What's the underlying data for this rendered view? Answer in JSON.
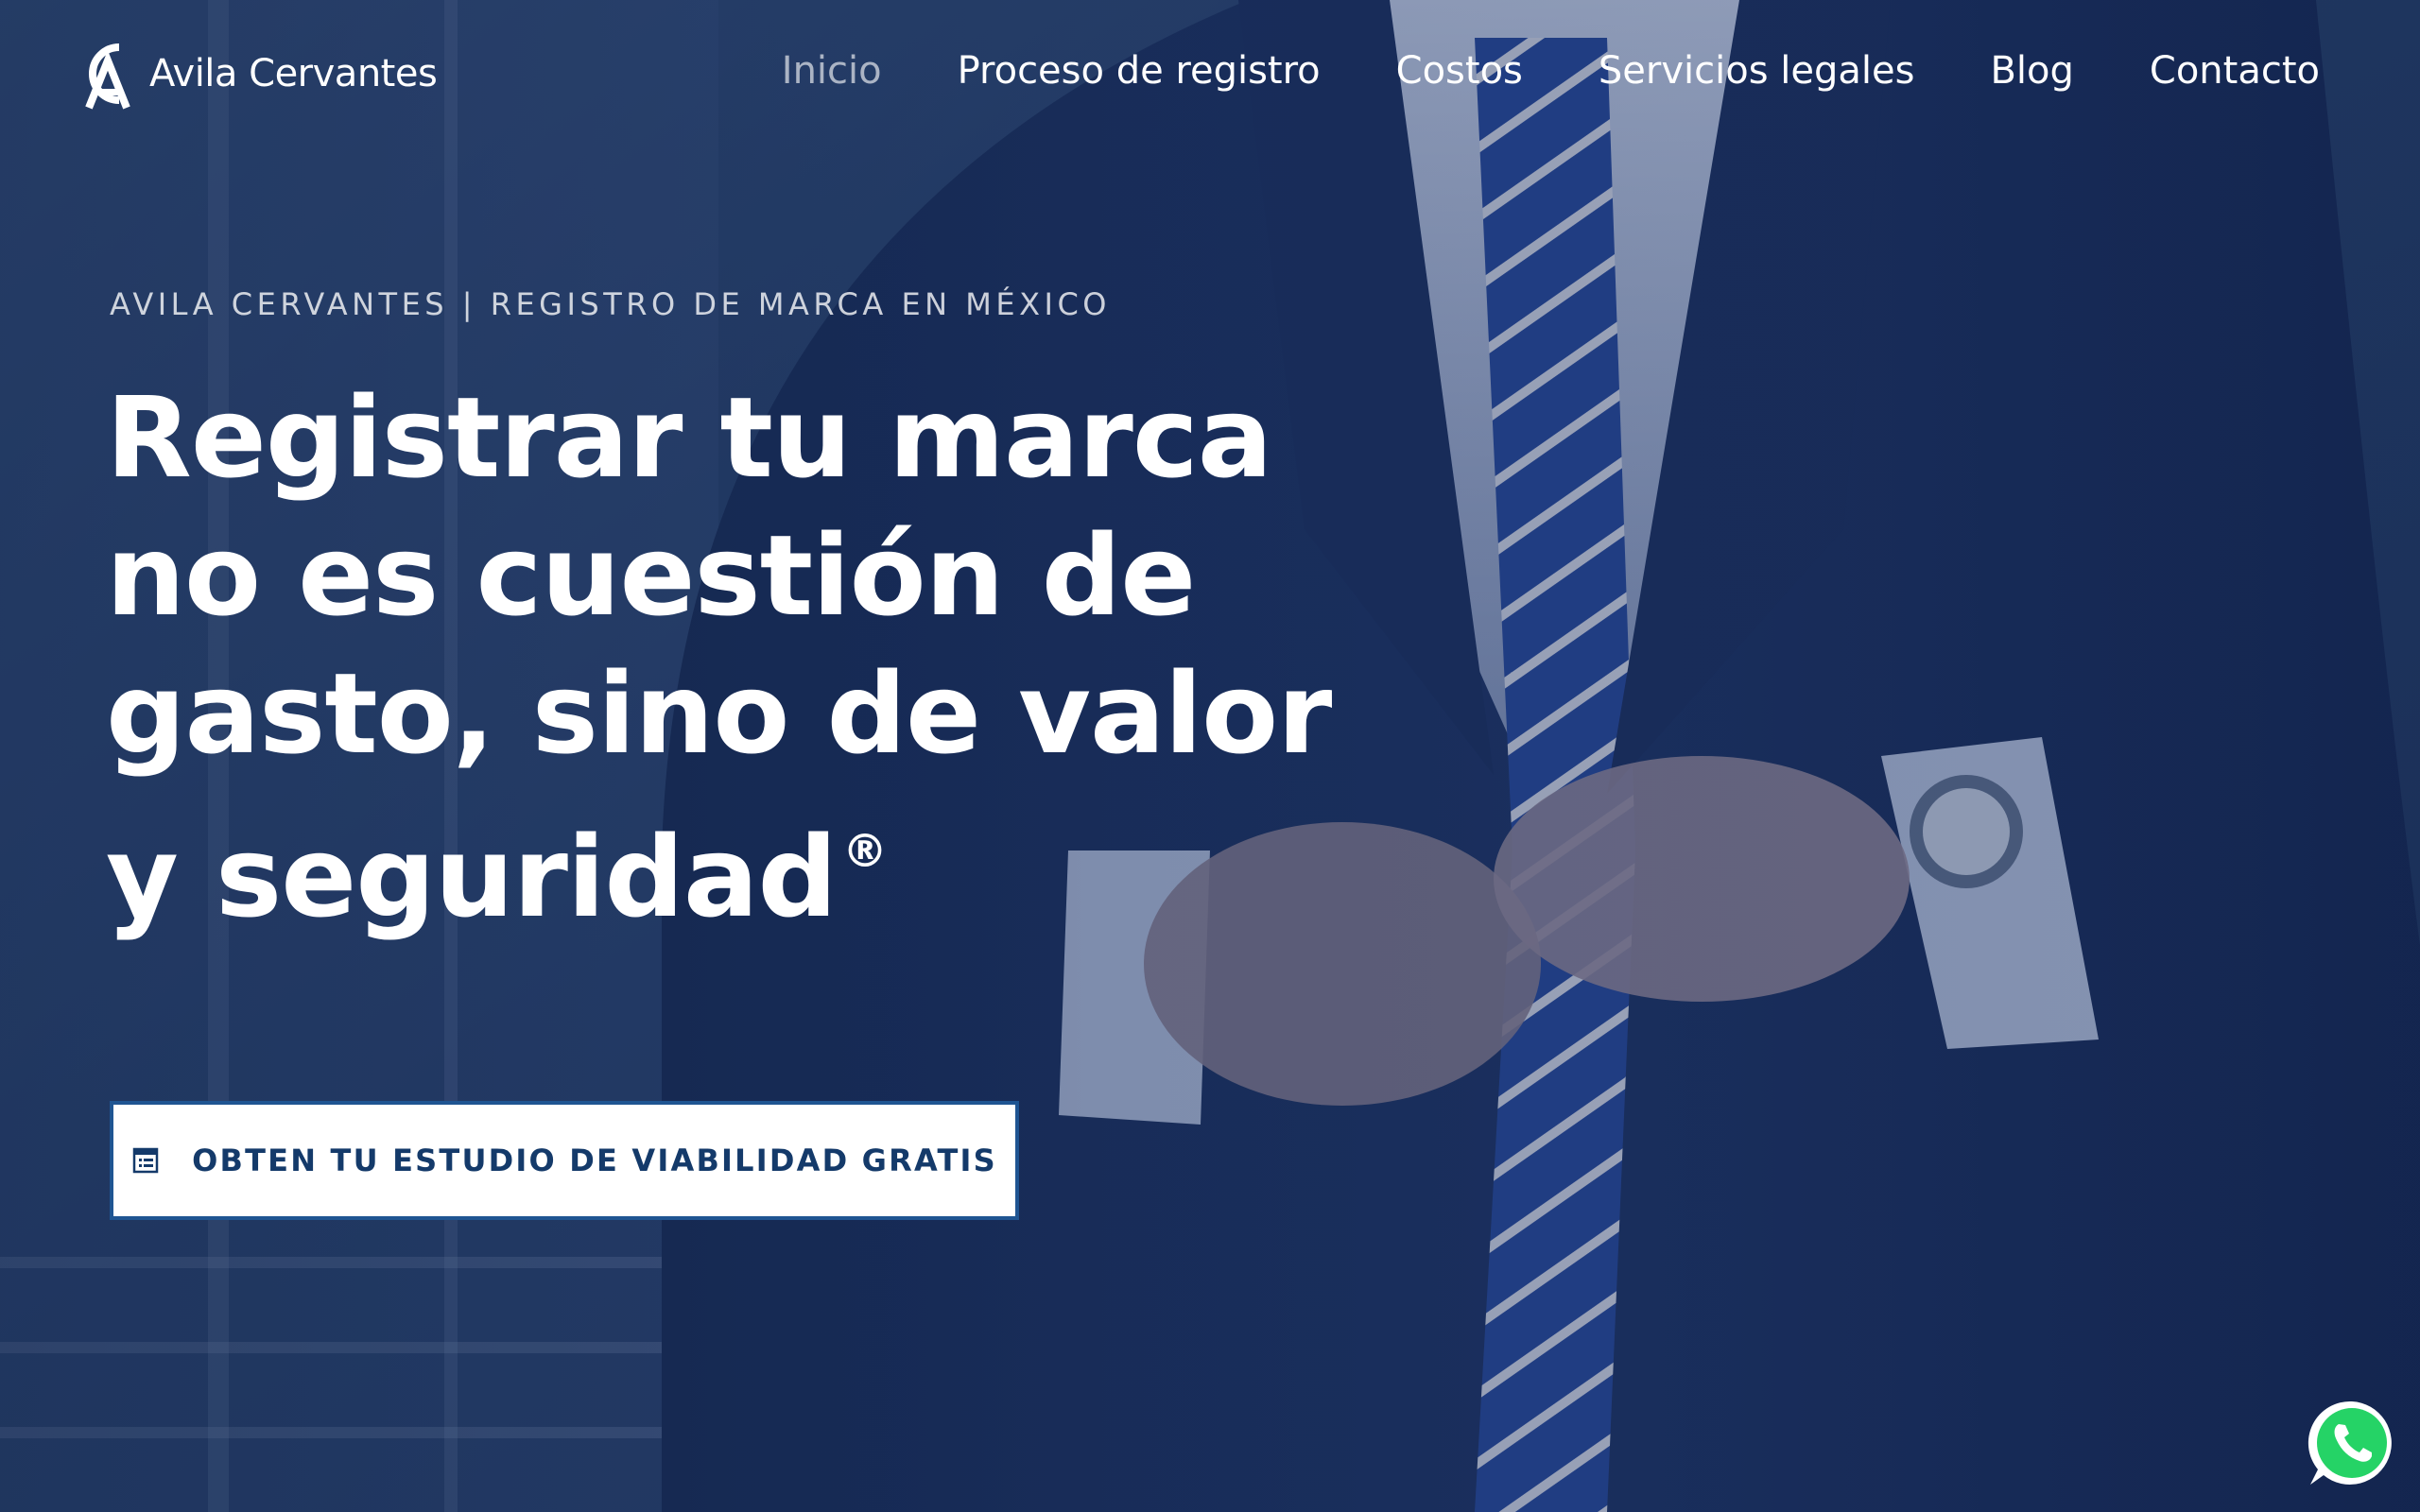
{
  "header": {
    "brand": "Avila Cervantes",
    "nav": [
      {
        "label": "Inicio",
        "active": true
      },
      {
        "label": "Proceso de registro",
        "active": false
      },
      {
        "label": "Costos",
        "active": false
      },
      {
        "label": "Servicios legales",
        "active": false
      },
      {
        "label": "Blog",
        "active": false
      },
      {
        "label": "Contacto",
        "active": false
      }
    ]
  },
  "hero": {
    "eyebrow": "AVILA CERVANTES | REGISTRO DE MARCA EN MÉXICO",
    "headline_lines": [
      "Registrar tu marca",
      "no es cuestión de",
      "gasto, sino de valor",
      "y seguridad"
    ],
    "trademark_symbol": "®",
    "cta": {
      "label": "OBTEN TU ESTUDIO DE VIABILIDAD GRATIS",
      "icon": "form-icon"
    }
  },
  "floating": {
    "whatsapp_icon": "whatsapp-icon"
  },
  "colors": {
    "accent": "#1f5592",
    "cta_text": "#143a6a",
    "whatsapp": "#25d366"
  }
}
